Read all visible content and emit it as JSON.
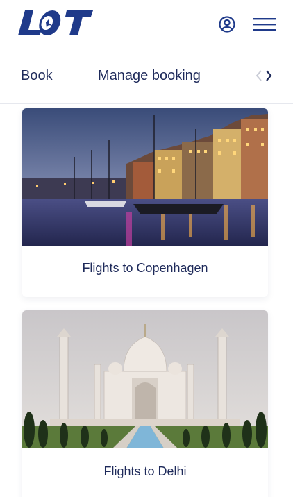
{
  "header": {
    "logo_text": "LOT",
    "logo_icon": "lot-logo",
    "user_icon": "user-account-icon",
    "menu_icon": "hamburger-menu-icon"
  },
  "nav": {
    "tabs": [
      {
        "label": "Book"
      },
      {
        "label": "Manage booking"
      }
    ],
    "prev_icon": "chevron-left-icon",
    "next_icon": "chevron-right-icon"
  },
  "cards": [
    {
      "title": "Flights to Copenhagen",
      "image": "copenhagen-nyhavn-photo"
    },
    {
      "title": "Flights to Delhi",
      "image": "taj-mahal-photo"
    }
  ],
  "colors": {
    "brand_navy": "#1e2a5a",
    "logo_blue": "#1f3a8a",
    "divider": "#e6e8ee"
  }
}
